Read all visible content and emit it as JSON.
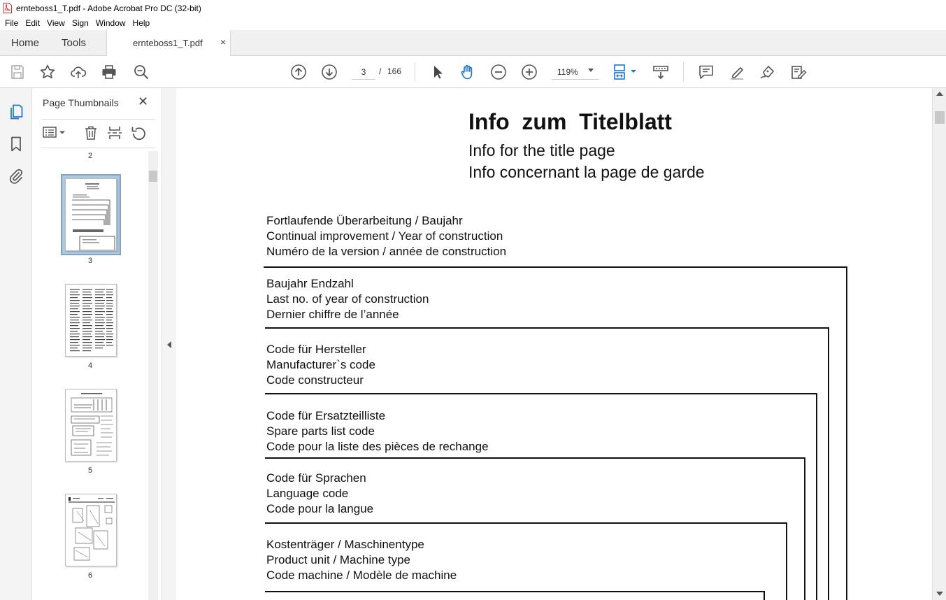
{
  "window": {
    "title": "ernteboss1_T.pdf - Adobe Acrobat Pro DC (32-bit)",
    "icon": "pdf-file-icon"
  },
  "menu": [
    "File",
    "Edit",
    "View",
    "Sign",
    "Window",
    "Help"
  ],
  "tabs": {
    "home": "Home",
    "tools": "Tools",
    "document": "ernteboss1_T.pdf",
    "close_glyph": "×"
  },
  "toolbar": {
    "current_page": "3",
    "page_separator": "/",
    "total_pages": "166",
    "zoom": "119%"
  },
  "thumbnails": {
    "title": "Page Thumbnails",
    "close_glyph": "✕",
    "pages": [
      {
        "label": "2"
      },
      {
        "label": "3",
        "selected": true
      },
      {
        "label": "4"
      },
      {
        "label": "5"
      },
      {
        "label": "6"
      }
    ]
  },
  "document": {
    "title": "Info  zum  Titelblatt",
    "subtitle_en": "Info for the title page",
    "subtitle_fr": "Info concernant la page de garde",
    "fields": [
      {
        "de": "Fortlaufende Überarbeitung / Baujahr",
        "en": "Continual improvement / Year of construction",
        "fr": "Numéro de la version / année de construction"
      },
      {
        "de": "Baujahr Endzahl",
        "en": "Last no. of year of construction",
        "fr": "Dernier chiffre de l’année"
      },
      {
        "de": "Code für Hersteller",
        "en": "Manufacturer`s  code",
        "fr": "Code constructeur"
      },
      {
        "de": "Code für Ersatzteilliste",
        "en": "Spare parts list code",
        "fr": "Code pour la liste des pièces de rechange"
      },
      {
        "de": "Code für Sprachen",
        "en": "Language code",
        "fr": "Code pour la langue"
      },
      {
        "de": "Kostenträger / Maschinentype",
        "en": "Product unit / Machine type",
        "fr": "Code machine / Modèle de machine"
      }
    ]
  },
  "colors": {
    "accent_blue": "#1a73c8",
    "thumb_selected": "#aec8e0"
  }
}
